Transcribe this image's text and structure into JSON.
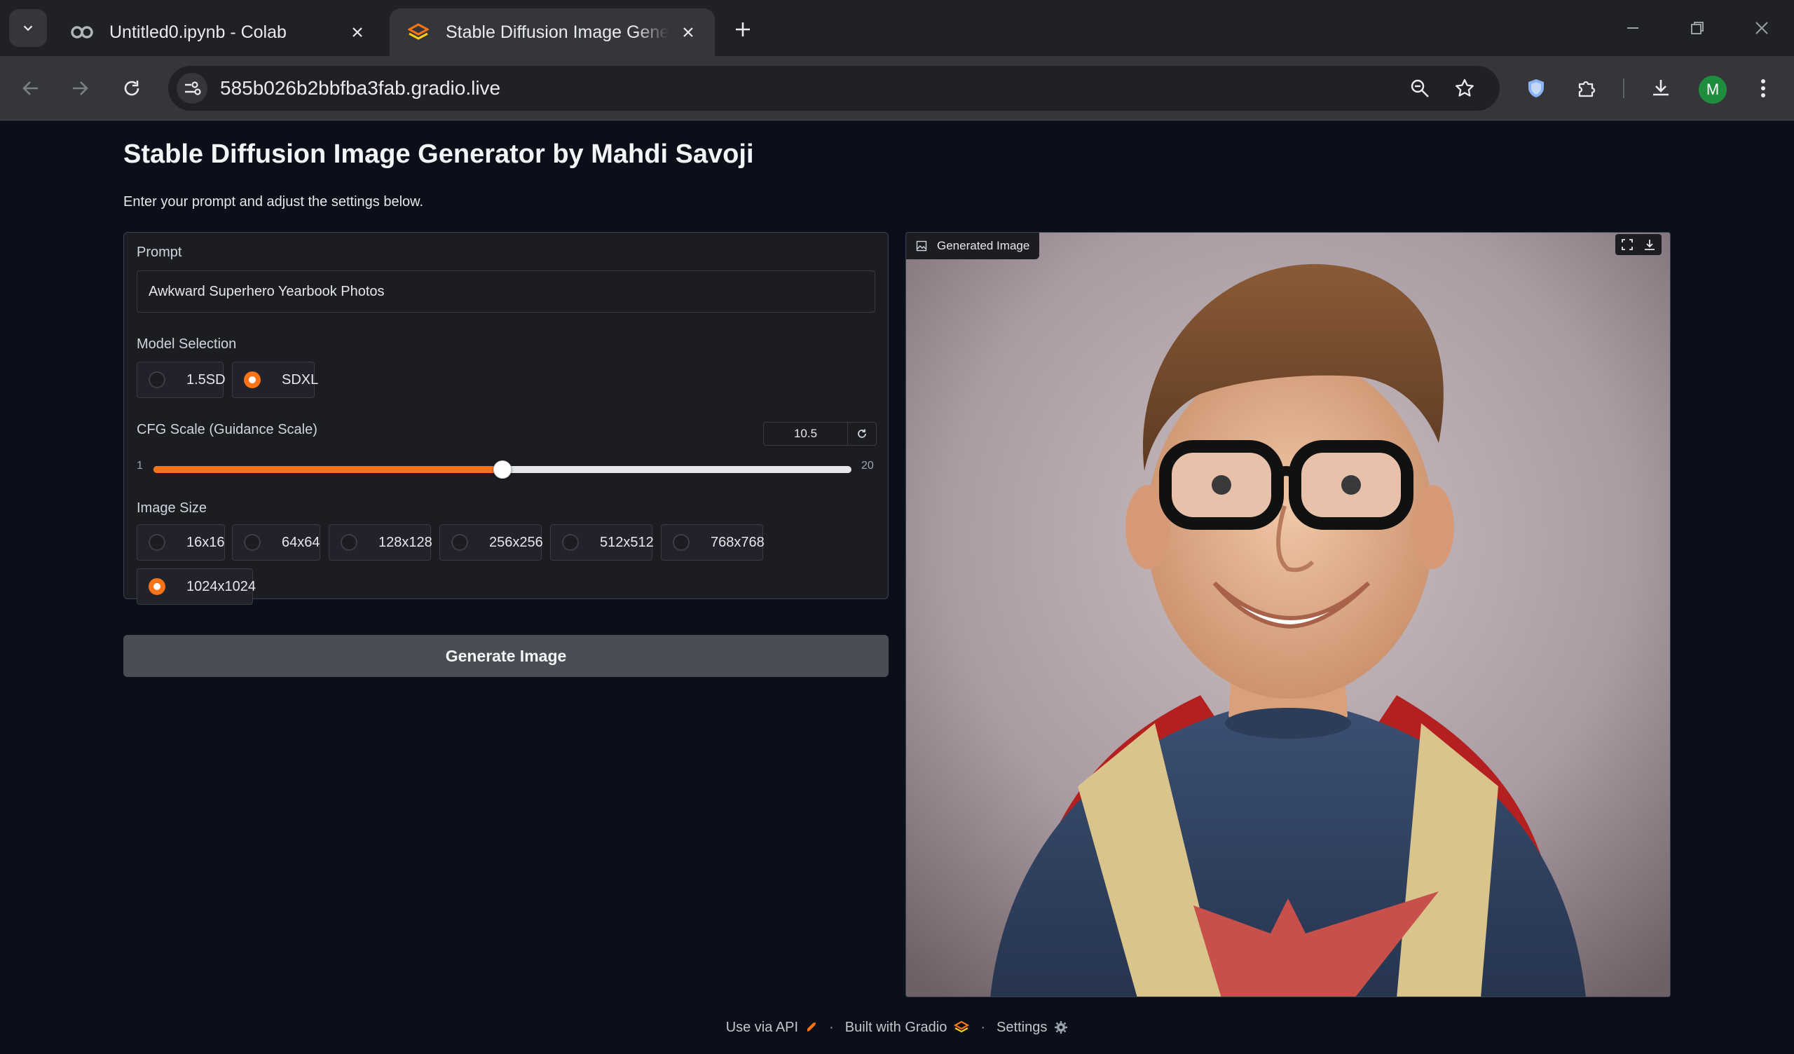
{
  "browser": {
    "tabs": [
      {
        "title": "Untitled0.ipynb - Colab",
        "active": false,
        "icon": "colab-icon"
      },
      {
        "title": "Stable Diffusion Image Generator by Mahdi Savoji",
        "active": true,
        "icon": "gradio-icon"
      }
    ],
    "url": "585b026b2bbfba3fab.gradio.live",
    "profile_initial": "M"
  },
  "app": {
    "title": "Stable Diffusion Image Generator by Mahdi Savoji",
    "description": "Enter your prompt and adjust the settings below.",
    "prompt": {
      "label": "Prompt",
      "value": "Awkward Superhero Yearbook Photos"
    },
    "model": {
      "label": "Model Selection",
      "options": [
        "1.5SD",
        "SDXL"
      ],
      "selected": "SDXL"
    },
    "cfg": {
      "label": "CFG Scale (Guidance Scale)",
      "value": "10.5",
      "min": "1",
      "max": "20",
      "fraction": 0.5
    },
    "size": {
      "label": "Image Size",
      "options": [
        "16x16",
        "64x64",
        "128x128",
        "256x256",
        "512x512",
        "768x768",
        "1024x1024"
      ],
      "selected": "1024x1024"
    },
    "generate_label": "Generate Image",
    "output_label": "Generated Image"
  },
  "footer": {
    "api": "Use via API",
    "built": "Built with Gradio",
    "settings": "Settings",
    "separator": "·"
  },
  "colors": {
    "accent": "#f97316",
    "background": "#0b0f19",
    "button": "#4b4d55"
  }
}
